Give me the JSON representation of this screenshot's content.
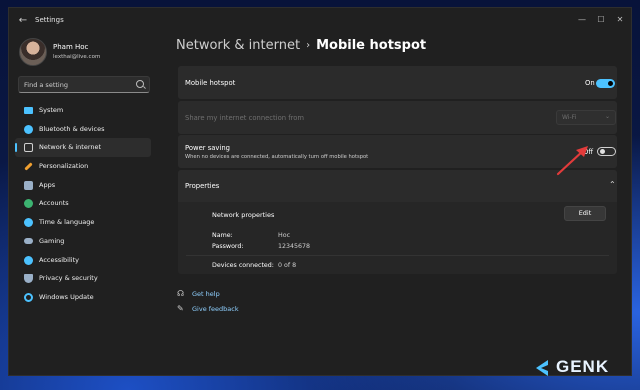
{
  "window": {
    "title": "Settings",
    "controls": {
      "minimize": "—",
      "maximize": "☐",
      "close": "✕"
    }
  },
  "profile": {
    "name": "Pham Hoc",
    "email": "lexthai@live.com"
  },
  "search": {
    "placeholder": "Find a setting"
  },
  "sidebar": {
    "items": [
      {
        "label": "System",
        "icon": "monitor-icon",
        "color": "#4cc2ff",
        "active": false
      },
      {
        "label": "Bluetooth & devices",
        "icon": "bluetooth-icon",
        "color": "#4cc2ff",
        "active": false
      },
      {
        "label": "Network & internet",
        "icon": "wifi-icon",
        "color": "#cfcfcf",
        "active": true
      },
      {
        "label": "Personalization",
        "icon": "brush-icon",
        "color": "#f0a030",
        "active": false
      },
      {
        "label": "Apps",
        "icon": "apps-icon",
        "color": "#9ab0c8",
        "active": false
      },
      {
        "label": "Accounts",
        "icon": "person-icon",
        "color": "#3cb371",
        "active": false
      },
      {
        "label": "Time & language",
        "icon": "globe-clock-icon",
        "color": "#4cc2ff",
        "active": false
      },
      {
        "label": "Gaming",
        "icon": "gamepad-icon",
        "color": "#9ab0c8",
        "active": false
      },
      {
        "label": "Accessibility",
        "icon": "accessibility-icon",
        "color": "#4cc2ff",
        "active": false
      },
      {
        "label": "Privacy & security",
        "icon": "shield-icon",
        "color": "#9ab0c8",
        "active": false
      },
      {
        "label": "Windows Update",
        "icon": "update-icon",
        "color": "#4cc2ff",
        "active": false
      }
    ]
  },
  "breadcrumb": {
    "parent": "Network & internet",
    "separator": "›",
    "current": "Mobile hotspot"
  },
  "mobile_hotspot": {
    "label": "Mobile hotspot",
    "state": "On",
    "on": true
  },
  "share_connection": {
    "label": "Share my internet connection from",
    "value": "Wi-Fi"
  },
  "power_saving": {
    "label": "Power saving",
    "description": "When no devices are connected, automatically turn off mobile hotspot",
    "state": "Off",
    "on": false
  },
  "properties": {
    "header": "Properties",
    "section_title": "Network properties",
    "edit_label": "Edit",
    "name_key": "Name:",
    "name_value": "Hoc",
    "password_key": "Password:",
    "password_value": "12345678",
    "devices_key": "Devices connected:",
    "devices_value": "0 of 8"
  },
  "links": {
    "help": "Get help",
    "feedback": "Give feedback"
  },
  "colors": {
    "accent": "#4cc2ff",
    "annotation": "#e23b3b"
  },
  "watermark": "GENK"
}
